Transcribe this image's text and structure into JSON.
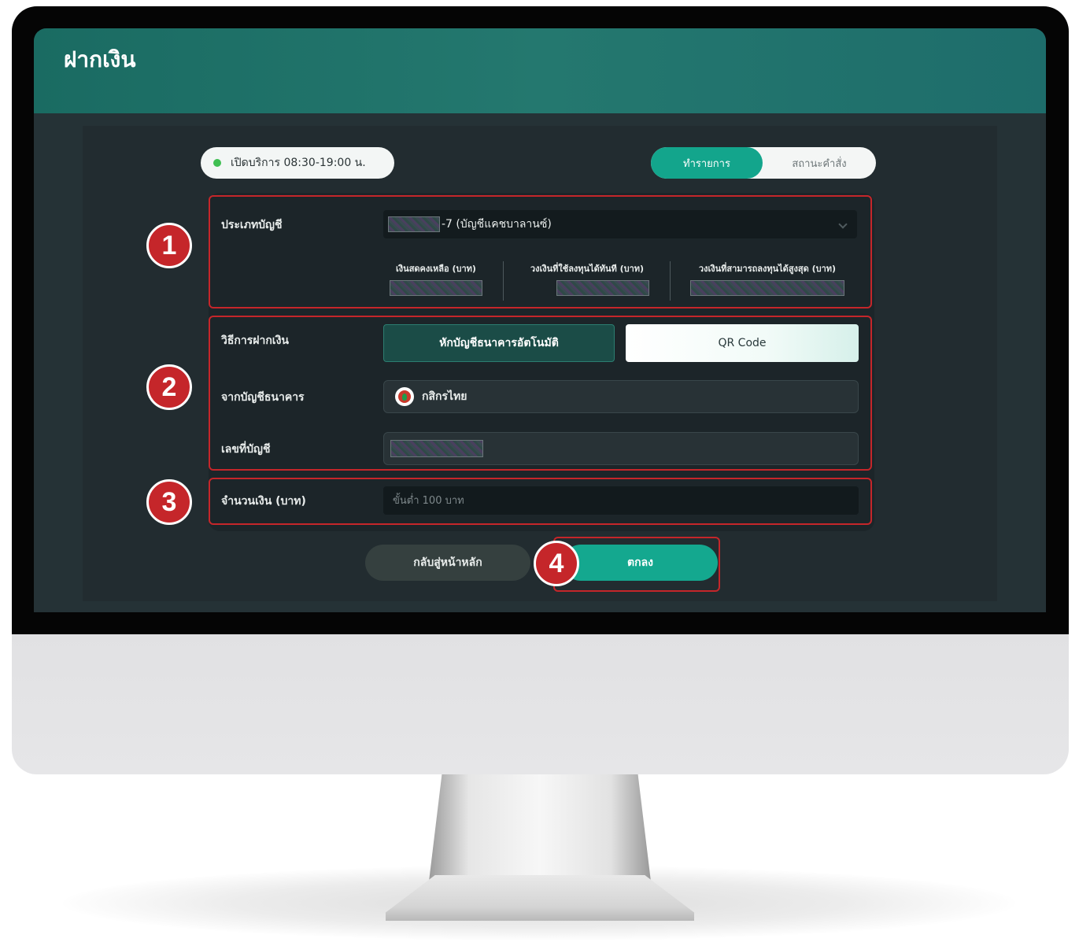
{
  "header": {
    "title": "ฝากเงิน"
  },
  "status": {
    "text": "เปิดบริการ 08:30-19:00 น."
  },
  "tabs": [
    {
      "label": "ทำรายการ",
      "active": true
    },
    {
      "label": "สถานะคำสั่ง",
      "active": false
    }
  ],
  "account_type": {
    "label": "ประเภทบัญชี",
    "value": "-7 (บัญชีแคชบาลานซ์)",
    "stats": [
      {
        "title": "เงินสดคงเหลือ (บาท)"
      },
      {
        "title": "วงเงินที่ใช้ลงทุนได้ทันที (บาท)"
      },
      {
        "title": "วงเงินที่สามารถลงทุนได้สูงสุด (บาท)"
      }
    ]
  },
  "deposit_method": {
    "label": "วิธีการฝากเงิน",
    "options": [
      "หักบัญชีธนาคารอัตโนมัติ",
      "QR Code"
    ]
  },
  "bank": {
    "label": "จากบัญชีธนาคาร",
    "value": "กสิกรไทย",
    "icon": "kasikorn-bank-logo-icon"
  },
  "account_number": {
    "label": "เลขที่บัญชี"
  },
  "amount": {
    "label": "จำนวนเงิน (บาท)",
    "placeholder": "ขั้นต่ำ 100 บาท"
  },
  "buttons": {
    "back": "กลับสู่หน้าหลัก",
    "ok": "ตกลง"
  },
  "callouts": [
    "1",
    "2",
    "3",
    "4"
  ],
  "colors": {
    "accent": "#14a88f",
    "header": "#1e6f69",
    "callout": "#c5262a",
    "background": "#253236"
  }
}
